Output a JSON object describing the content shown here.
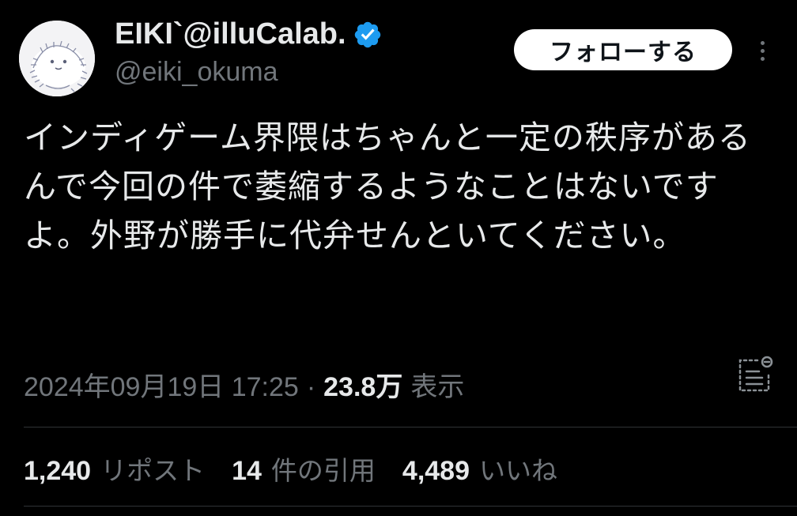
{
  "user": {
    "display_name": "EIKI`@illuCalab.",
    "handle": "@eiki_okuma"
  },
  "actions": {
    "follow_label": "フォローする"
  },
  "tweet": {
    "text": "インディゲーム界隈はちゃんと一定の秩序があるんで今回の件で萎縮するようなことはないですよ。外野が勝手に代弁せんといてください。",
    "timestamp": "2024年09月19日 17:25",
    "separator": "·",
    "views_count": "23.8万",
    "views_label": "表示"
  },
  "stats": {
    "reposts_count": "1,240",
    "reposts_label": "リポスト",
    "quotes_count": "14",
    "quotes_label": "件の引用",
    "likes_count": "4,489",
    "likes_label": "いいね"
  },
  "icons": {
    "verified": "verified-badge-icon",
    "more": "more-options-icon",
    "analytics": "analytics-icon"
  },
  "colors": {
    "background": "#000000",
    "text_primary": "#e7e9ea",
    "text_secondary": "#71767b",
    "verified_blue": "#1d9bf0",
    "divider": "#2f3336"
  }
}
